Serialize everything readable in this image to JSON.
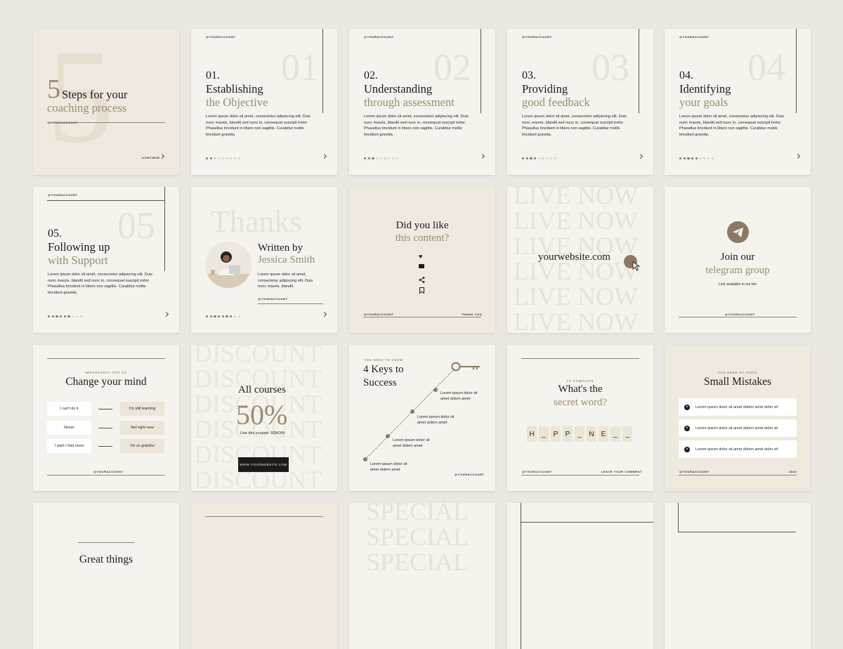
{
  "account": "@YOURACCOUNT",
  "cover": {
    "big_num": "5",
    "title_a": "Steps for your",
    "title_b": "coaching process",
    "continue": "CONTINUE"
  },
  "steps": [
    {
      "num": "01.",
      "ghost": "01",
      "l1": "Establishing",
      "l2": "the Objective",
      "dots_on": 2
    },
    {
      "num": "02.",
      "ghost": "02",
      "l1": "Understanding",
      "l2": "through assessment",
      "dots_on": 3
    },
    {
      "num": "03.",
      "ghost": "03",
      "l1": "Providing",
      "l2": "good feedback",
      "dots_on": 4
    },
    {
      "num": "04.",
      "ghost": "04",
      "l1": "Identifying",
      "l2": "your goals",
      "dots_on": 5
    },
    {
      "num": "05.",
      "ghost": "05",
      "l1": "Following up",
      "l2": "with Support",
      "dots_on": 6
    }
  ],
  "lorem_body": "Lorem ipsum dolor sit amet, consectetur adipiscing elit. Duis nunc mauris, blandit sed nunc in, consequat suscipit tortor. Phasellus tincidunt in libero non sagittis. Curabitur mollis tincidunt gravida.",
  "author": {
    "ghost": "Thanks",
    "l1": "Written by",
    "l2": "Jessica Smith",
    "text": "Lorem ipsum dolor sit amet, consectetur adipiscing elit. Duis nunc mauris, blandit."
  },
  "like": {
    "l1": "Did you like",
    "l2": "this content?",
    "thank": "THANK YOU"
  },
  "live": {
    "ghost": "LIVE NOW",
    "site": "yourwebsite.com"
  },
  "telegram": {
    "l1": "Join our",
    "l2": "telegram group",
    "sub": "Link available in our bio"
  },
  "mind": {
    "kicker": "IMPORTANTS TIPS TO",
    "title": "Change your mind",
    "rows": [
      {
        "from": "I can't do it",
        "to": "I'm still learning"
      },
      {
        "from": "Never",
        "to": "Not right now"
      },
      {
        "from": "I wish I had more",
        "to": "I'm so grateful"
      }
    ]
  },
  "discount": {
    "ghost": "DISCOUNT",
    "title": "All courses",
    "pct": "50%",
    "coupon": "Use this coupon: 50NOW",
    "btn": "WWW.YOURWEBSITE.COM"
  },
  "keys": {
    "kicker": "YOU NEED TO KNOW",
    "l1": "4 Keys to",
    "l2": "Success",
    "items": [
      "Lorem ipsum dolor sit amet dolem amet",
      "Lorem ipsum dolor sit amet dolem amet",
      "Lorem ipsum dolor sit amet dolem amet",
      "Lorem ipsum dolor sit amet dolem amet"
    ]
  },
  "secret": {
    "kicker": "TO COMPLETE",
    "l1": "What's the",
    "l2": "secret word?",
    "letters": [
      "H",
      "_",
      "P",
      "P",
      "_",
      "N",
      "E",
      "_",
      "_"
    ],
    "leave": "LEAVE YOUR COMMENT"
  },
  "mistakes": {
    "kicker": "YOU NEED TO AVOID",
    "title": "Small Mistakes",
    "items": [
      "Lorem ipsum dolor sit amet dolem amet dolm sit",
      "Lorem ipsum dolor sit amet dolem amet dolm sit",
      "Lorem ipsum dolor sit amet dolem amet dolm sit"
    ],
    "year": "2022"
  },
  "row4": {
    "great": "Great things",
    "special": "SPECIAL"
  }
}
